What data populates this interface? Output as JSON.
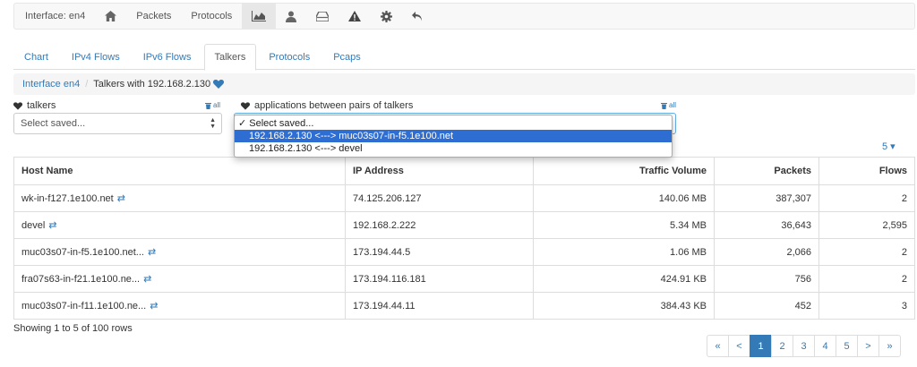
{
  "navbar": {
    "interface_label": "Interface: en4",
    "packets_label": "Packets",
    "protocols_label": "Protocols",
    "icons": [
      "home-icon",
      "area-chart-icon",
      "user-icon",
      "hard-drive-icon",
      "warning-icon",
      "gear-icon",
      "undo-icon"
    ]
  },
  "tabs": [
    "Chart",
    "IPv4 Flows",
    "IPv6 Flows",
    "Talkers",
    "Protocols",
    "Pcaps"
  ],
  "active_tab": "Talkers",
  "breadcrumb": {
    "link": "Interface en4",
    "current": "Talkers with 192.168.2.130"
  },
  "filters": {
    "talkers_label": "talkers",
    "talkers_all": "all",
    "talkers_select": "Select saved...",
    "apps_label": "applications between pairs of talkers",
    "apps_all": "all",
    "dropdown_options": [
      "✓ Select saved...",
      "192.168.2.130 <---> muc03s07-in-f5.1e100.net",
      "192.168.2.130 <---> devel"
    ]
  },
  "page_size": "5 ▾",
  "table": {
    "headers": [
      "Host Name",
      "IP Address",
      "Traffic Volume",
      "Packets",
      "Flows"
    ],
    "rows": [
      [
        "wk-in-f127.1e100.net",
        "74.125.206.127",
        "140.06 MB",
        "387,307",
        "2"
      ],
      [
        "devel",
        "192.168.2.222",
        "5.34 MB",
        "36,643",
        "2,595"
      ],
      [
        "muc03s07-in-f5.1e100.net...",
        "173.194.44.5",
        "1.06 MB",
        "2,066",
        "2"
      ],
      [
        "fra07s63-in-f21.1e100.ne...",
        "173.194.116.181",
        "424.91 KB",
        "756",
        "2"
      ],
      [
        "muc03s07-in-f11.1e100.ne...",
        "173.194.44.11",
        "384.43 KB",
        "452",
        "3"
      ]
    ]
  },
  "footer": {
    "showing": "Showing 1 to 5 of 100 rows",
    "pages": [
      "«",
      "<",
      "1",
      "2",
      "3",
      "4",
      "5",
      ">",
      "»"
    ]
  },
  "colors": {
    "accent": "#337ab7",
    "highlight": "#2e6ed3"
  }
}
